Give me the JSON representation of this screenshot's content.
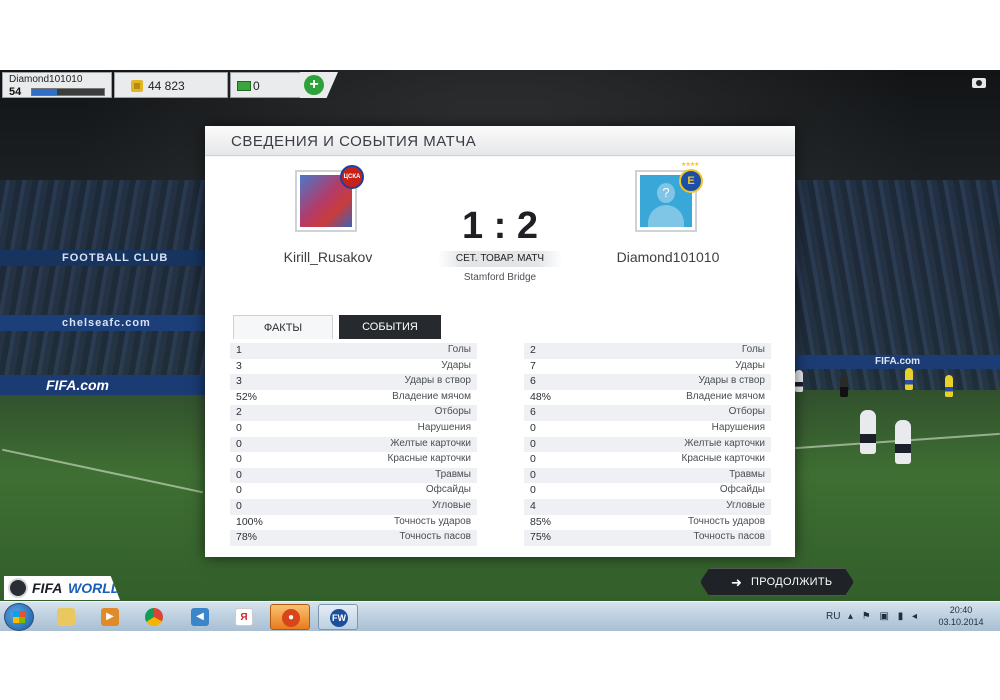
{
  "hud": {
    "username": "Diamond101010",
    "level": "54",
    "level_progress": 0.35,
    "coins": "44 823",
    "points": "0",
    "add_label": "+"
  },
  "panel": {
    "title": "СВЕДЕНИЯ И СОБЫТИЯ МАТЧА",
    "home_name": "Kirill_Rusakov",
    "away_name": "Diamond101010",
    "score": "1 : 2",
    "match_type": "СЕТ. ТОВАР. МАТЧ",
    "stadium": "Stamford Bridge",
    "home_badge": "ЦСКА",
    "away_badge": "Е"
  },
  "tabs": {
    "facts": "ФАКТЫ",
    "events": "СОБЫТИЯ"
  },
  "stats": {
    "home": [
      {
        "value": "1",
        "label": "Голы"
      },
      {
        "value": "3",
        "label": "Удары"
      },
      {
        "value": "3",
        "label": "Удары в створ"
      },
      {
        "value": "52%",
        "label": "Владение мячом"
      },
      {
        "value": "2",
        "label": "Отборы"
      },
      {
        "value": "0",
        "label": "Нарушения"
      },
      {
        "value": "0",
        "label": "Желтые карточки"
      },
      {
        "value": "0",
        "label": "Красные карточки"
      },
      {
        "value": "0",
        "label": "Травмы"
      },
      {
        "value": "0",
        "label": "Офсайды"
      },
      {
        "value": "0",
        "label": "Угловые"
      },
      {
        "value": "100%",
        "label": "Точность ударов"
      },
      {
        "value": "78%",
        "label": "Точность пасов"
      }
    ],
    "away": [
      {
        "value": "2",
        "label": "Голы"
      },
      {
        "value": "7",
        "label": "Удары"
      },
      {
        "value": "6",
        "label": "Удары в створ"
      },
      {
        "value": "48%",
        "label": "Владение мячом"
      },
      {
        "value": "6",
        "label": "Отборы"
      },
      {
        "value": "0",
        "label": "Нарушения"
      },
      {
        "value": "0",
        "label": "Желтые карточки"
      },
      {
        "value": "0",
        "label": "Красные карточки"
      },
      {
        "value": "0",
        "label": "Травмы"
      },
      {
        "value": "0",
        "label": "Офсайды"
      },
      {
        "value": "4",
        "label": "Угловые"
      },
      {
        "value": "85%",
        "label": "Точность ударов"
      },
      {
        "value": "75%",
        "label": "Точность пасов"
      }
    ]
  },
  "background": {
    "banner_left": "chelseafc.com",
    "banner_club": "FOOTBALL CLUB",
    "banner_fifa": "FIFA.com",
    "banner_right": "FIFA.com"
  },
  "footer": {
    "logo_fifa": "FIFA",
    "logo_world": "WORLD",
    "continue_label": "ПРОДОЛЖИТЬ"
  },
  "taskbar": {
    "language": "RU",
    "time": "20:40",
    "date": "03.10.2014",
    "apps": [
      "explorer-icon",
      "media-player-icon",
      "chrome-icon",
      "volume-app-icon",
      "yandex-icon",
      "music-player-icon",
      "fifa-world-icon"
    ]
  },
  "colors": {
    "accent_green": "#2da13a",
    "xp_blue": "#2f6fc6",
    "dark_tab": "#26292d"
  }
}
